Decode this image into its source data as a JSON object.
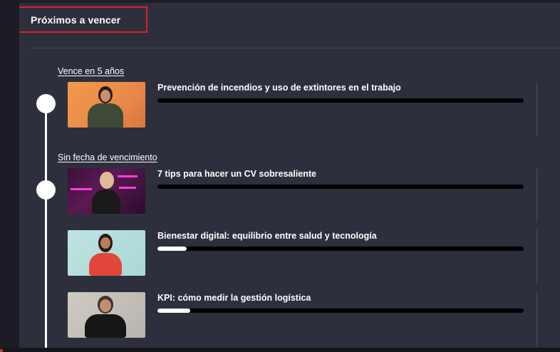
{
  "header": {
    "title": "Próximos a vencer"
  },
  "groups": [
    {
      "label": "Vence en 5 años",
      "courses": [
        {
          "title": "Prevención de incendios y uso de extintores en el trabajo",
          "progress": 0.0
        }
      ]
    },
    {
      "label": "Sin fecha de vencimiento",
      "courses": [
        {
          "title": "7 tips para hacer un CV sobresaliente",
          "progress": 0.0
        },
        {
          "title": "Bienestar digital: equilibrio entre salud y tecnología",
          "progress": 0.08
        },
        {
          "title": "KPI: cómo medir la gestión logística",
          "progress": 0.09
        }
      ]
    }
  ],
  "colors": {
    "background": "#2e2f3d",
    "highlight_border": "#e41e26",
    "progress_track": "#000000",
    "progress_fill": "#ffffff"
  }
}
